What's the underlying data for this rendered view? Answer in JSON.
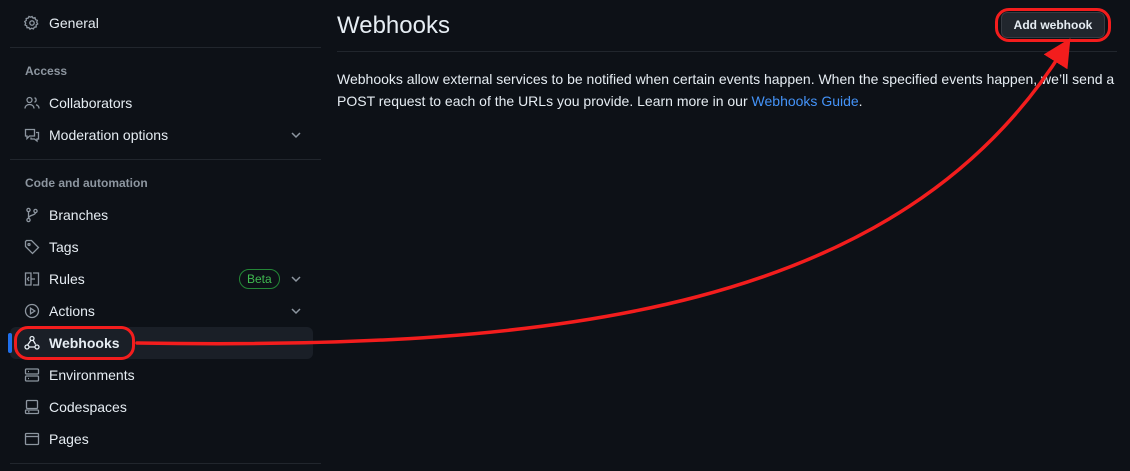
{
  "sidebar": {
    "general": "General",
    "sections": {
      "access": "Access",
      "code_automation": "Code and automation"
    },
    "items": {
      "collaborators": "Collaborators",
      "moderation": "Moderation options",
      "branches": "Branches",
      "tags": "Tags",
      "rules": "Rules",
      "rules_badge": "Beta",
      "actions": "Actions",
      "webhooks": "Webhooks",
      "environments": "Environments",
      "codespaces": "Codespaces",
      "pages": "Pages"
    }
  },
  "main": {
    "title": "Webhooks",
    "add_button": "Add webhook",
    "description": "Webhooks allow external services to be notified when certain events happen. When the specified events happen, we’ll send a POST request to each of the URLs you provide. Learn more in our ",
    "link": "Webhooks Guide",
    "description_end": "."
  },
  "colors": {
    "background": "#0d1117",
    "accent_link": "#4493f8",
    "active_indicator": "#1f6feb",
    "annotation": "#f31d1d",
    "beta": "#3fb950"
  },
  "icons": [
    "gear-icon",
    "people-icon",
    "comment-discussion-icon",
    "git-branch-icon",
    "tag-icon",
    "rules-icon",
    "play-icon",
    "webhook-icon",
    "server-icon",
    "codespaces-icon",
    "browser-icon",
    "chevron-down-icon"
  ]
}
